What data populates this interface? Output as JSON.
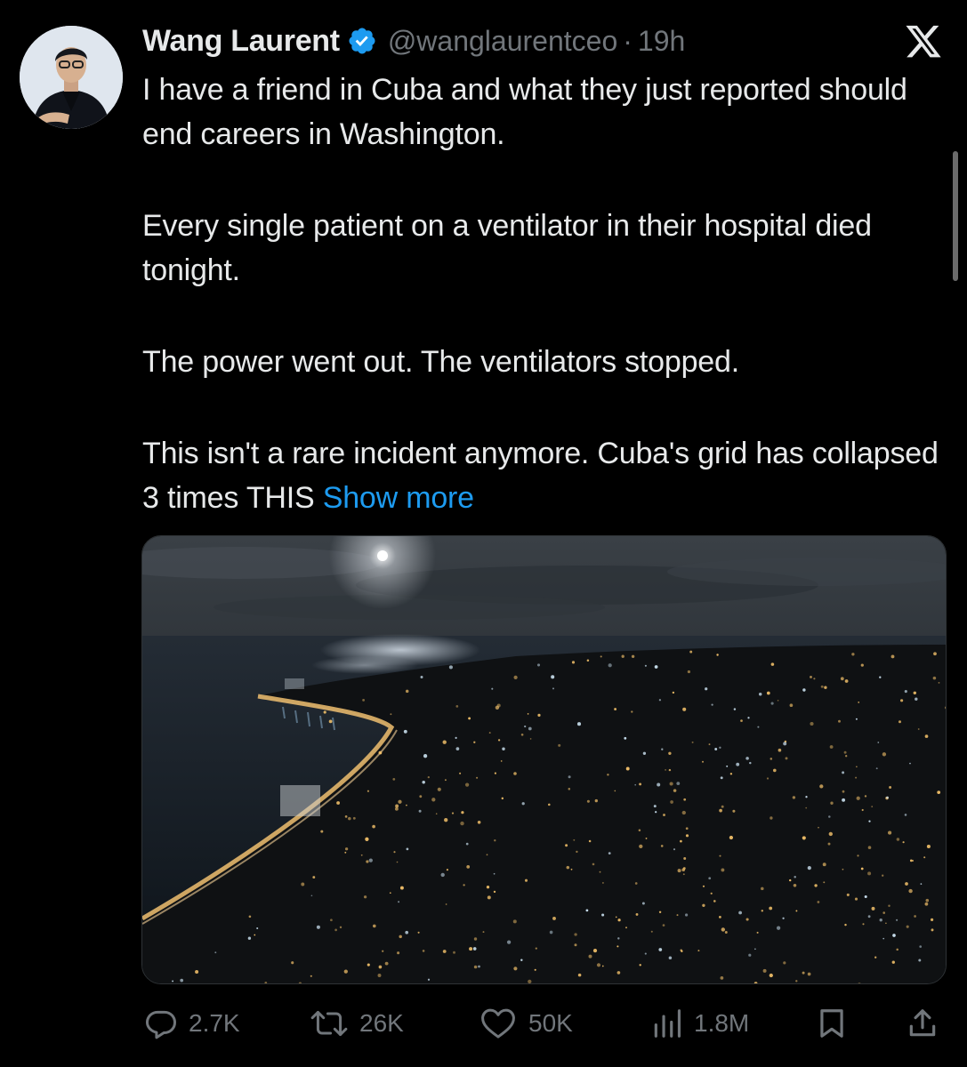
{
  "tweet": {
    "author": {
      "name": "Wang Laurent",
      "handle": "@wanglaurentceo",
      "verified_icon": "verified-badge-icon"
    },
    "separator": "·",
    "timestamp": "19h",
    "platform_logo": "x-logo-icon",
    "paragraphs": [
      "I have a friend in Cuba and what they just reported should end careers in Washington.",
      "Every single patient on a ventilator in their hospital died tonight.",
      "The power went out. The ventilators stopped."
    ],
    "last_paragraph_text": "This isn't a rare incident anymore. Cuba's grid has collapsed 3 times THIS",
    "show_more_label": "Show more",
    "media_alt": "Night aerial view of a dark city coastline under moonlight",
    "metrics": {
      "replies": "2.7K",
      "reposts": "26K",
      "likes": "50K",
      "views": "1.8M"
    }
  },
  "colors": {
    "background": "#000000",
    "text": "#e7e9ea",
    "secondary": "#71767b",
    "link": "#1d9bf0",
    "verified": "#1d9bf0"
  }
}
